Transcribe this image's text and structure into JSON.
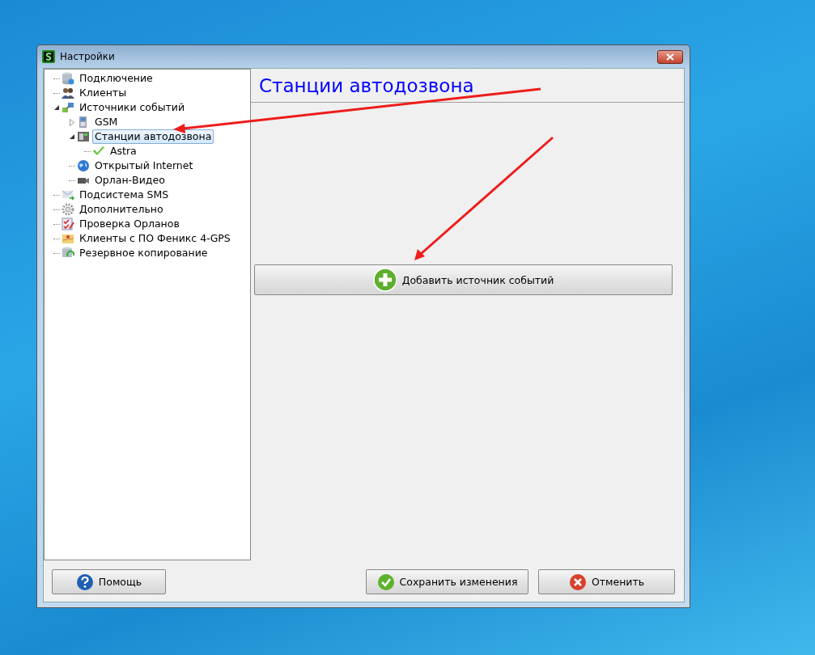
{
  "window": {
    "title": "Настройки"
  },
  "tree": {
    "items": [
      {
        "label": "Подключение",
        "selected": false
      },
      {
        "label": "Клиенты",
        "selected": false
      },
      {
        "label": "Источники событий",
        "selected": false,
        "expanded": true,
        "children": [
          {
            "label": "GSM",
            "selected": false,
            "expanded": false
          },
          {
            "label": "Станции автодозвона",
            "selected": true,
            "expanded": true,
            "children": [
              {
                "label": "Astra",
                "selected": false
              }
            ]
          },
          {
            "label": "Открытый Internet",
            "selected": false
          },
          {
            "label": "Орлан-Видео",
            "selected": false
          }
        ]
      },
      {
        "label": "Подсистема SMS",
        "selected": false
      },
      {
        "label": "Дополнительно",
        "selected": false
      },
      {
        "label": "Проверка Орланов",
        "selected": false
      },
      {
        "label": "Клиенты с ПО Феникс 4-GPS",
        "selected": false
      },
      {
        "label": "Резервное копирование",
        "selected": false
      }
    ]
  },
  "panel": {
    "heading": "Станции автодозвона",
    "add_button": "Добавить источник событий"
  },
  "buttons": {
    "help": "Помощь",
    "save": "Сохранить изменения",
    "cancel": "Отменить"
  }
}
